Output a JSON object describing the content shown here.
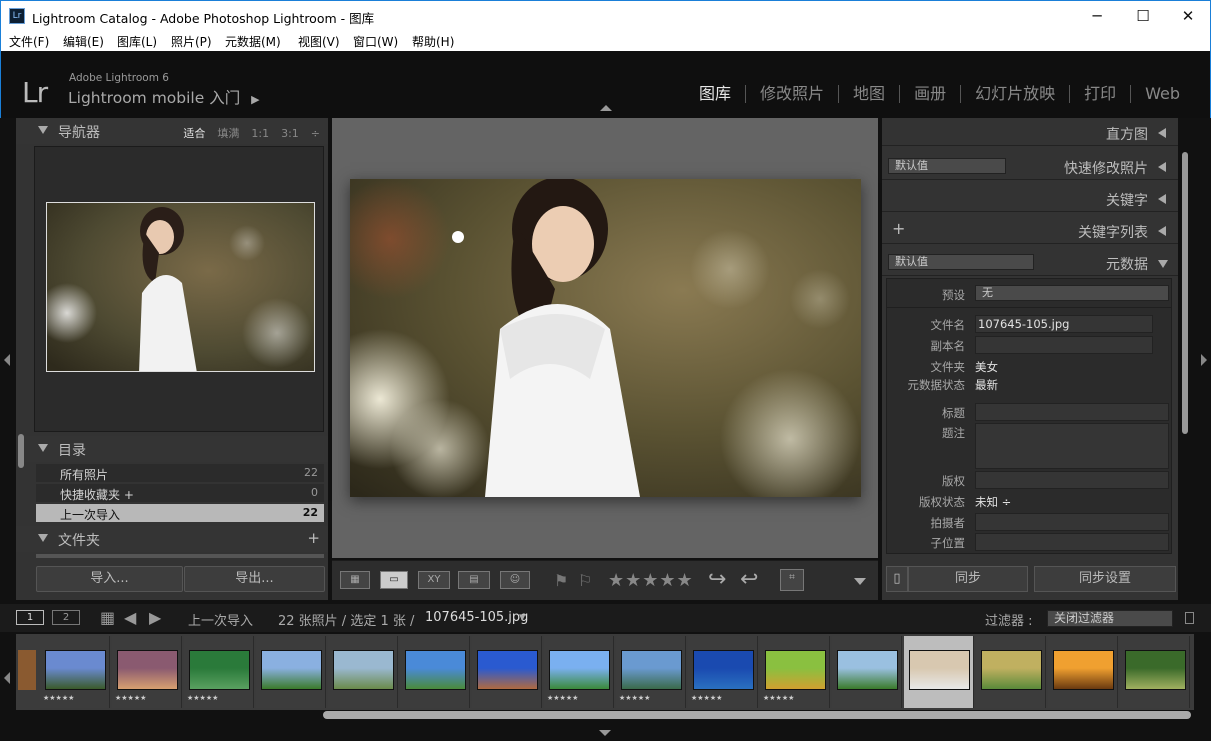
{
  "window": {
    "title": "Lightroom Catalog - Adobe Photoshop Lightroom - 图库",
    "icon": "Lr",
    "minimize": "─",
    "maximize": "☐",
    "close": "✕"
  },
  "menu": [
    "文件(F)",
    "编辑(E)",
    "图库(L)",
    "照片(P)",
    "元数据(M)",
    "视图(V)",
    "窗口(W)",
    "帮助(H)"
  ],
  "identity": {
    "logo": "Lr",
    "version": "Adobe Lightroom 6",
    "mobile": "Lightroom mobile 入门",
    "arrow": "▶"
  },
  "modules": [
    {
      "label": "图库",
      "active": true
    },
    {
      "label": "修改照片"
    },
    {
      "label": "地图"
    },
    {
      "label": "画册"
    },
    {
      "label": "幻灯片放映"
    },
    {
      "label": "打印"
    },
    {
      "label": "Web"
    }
  ],
  "navigator": {
    "title": "导航器",
    "opts": [
      "适合",
      "填满",
      "1:1",
      "3:1"
    ],
    "active": "适合",
    "stepper": "÷"
  },
  "catalog": {
    "title": "目录",
    "items": [
      {
        "label": "所有照片",
        "count": "22"
      },
      {
        "label": "快捷收藏夹 +",
        "count": "0"
      },
      {
        "label": "上一次导入",
        "count": "22",
        "selected": true
      }
    ]
  },
  "folders": {
    "title": "文件夹",
    "plus": "+"
  },
  "left_buttons": {
    "import": "导入...",
    "export": "导出..."
  },
  "right": {
    "histogram": "直方图",
    "quick": {
      "preset": "默认值",
      "title": "快速修改照片"
    },
    "keywords": "关键字",
    "keywordlist": {
      "plus": "+",
      "title": "关键字列表"
    },
    "metadata": {
      "preset": "默认值",
      "title": "元数据"
    },
    "fields": {
      "preset_label": "预设",
      "preset_value": "无",
      "filename_label": "文件名",
      "filename_value": "107645-105.jpg",
      "copyname_label": "副本名",
      "folder_label": "文件夹",
      "folder_value": "美女",
      "status_label": "元数据状态",
      "status_value": "最新",
      "title_label": "标题",
      "caption_label": "题注",
      "copyright_label": "版权",
      "cstatus_label": "版权状态",
      "cstatus_value": "未知 ÷",
      "creator_label": "拍摄者",
      "subloc_label": "子位置"
    },
    "sync": "同步",
    "syncset": "同步设置"
  },
  "toolbar": {
    "stars": "★★★★★"
  },
  "filmstrip_bar": {
    "page1": "1",
    "page2": "2",
    "source": "上一次导入",
    "count": "22 张照片 / 选定 1 张 /",
    "file": "107645-105.jpg",
    "dd": "▾",
    "filter_label": "过滤器 :",
    "filter_value": "关闭过滤器"
  },
  "thumbs": [
    {
      "c1": "#6a8ad0",
      "c2": "#3a5a2a",
      "stars": "★★★★★"
    },
    {
      "c1": "#8a5a70",
      "c2": "#d8a070",
      "stars": "★★★★★"
    },
    {
      "c1": "#2a7a3a",
      "c2": "#5aa060",
      "stars": "★★★★★"
    },
    {
      "c1": "#8ab0e0",
      "c2": "#3a7a2a",
      "stars": ""
    },
    {
      "c1": "#9ab8d0",
      "c2": "#6a8a4a",
      "stars": ""
    },
    {
      "c1": "#4a8ad8",
      "c2": "#4a8a3a",
      "stars": ""
    },
    {
      "c1": "#2a5ad0",
      "c2": "#b06a40",
      "stars": ""
    },
    {
      "c1": "#7ab0f0",
      "c2": "#3a8a3a",
      "stars": "★★★★★"
    },
    {
      "c1": "#6a9ad0",
      "c2": "#3a6a4a",
      "stars": "★★★★★"
    },
    {
      "c1": "#1a4ab0",
      "c2": "#2a70c0",
      "stars": "★★★★★"
    },
    {
      "c1": "#8ac040",
      "c2": "#d0a030",
      "stars": "★★★★★"
    },
    {
      "c1": "#9ac0e0",
      "c2": "#3a7a2a",
      "stars": ""
    },
    {
      "c1": "#d8c8b0",
      "c2": "#e8e8e8",
      "stars": "",
      "selected": true
    },
    {
      "c1": "#c0b060",
      "c2": "#5a8a3a",
      "stars": ""
    },
    {
      "c1": "#f0a030",
      "c2": "#6a3a10",
      "stars": ""
    },
    {
      "c1": "#3a6a2a",
      "c2": "#a0b060",
      "stars": ""
    }
  ]
}
